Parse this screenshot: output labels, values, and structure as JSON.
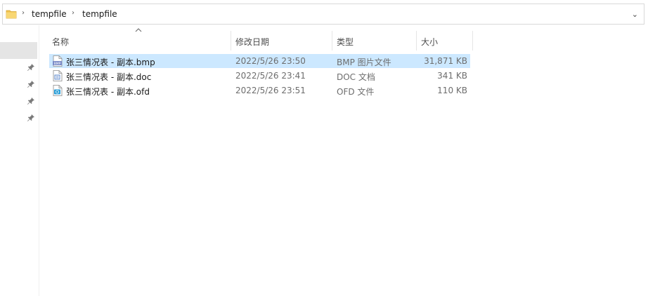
{
  "address": {
    "crumbs": [
      "tempfile",
      "tempfile"
    ],
    "separator": "›",
    "dropdown": "⌄"
  },
  "columns": {
    "name": "名称",
    "date": "修改日期",
    "type": "类型",
    "size": "大小"
  },
  "files": [
    {
      "name": "张三情况表 - 副本.bmp",
      "date": "2022/5/26 23:50",
      "type": "BMP 图片文件",
      "size": "31,871 KB",
      "icon": "bmp-file-icon",
      "selected": true
    },
    {
      "name": "张三情况表 - 副本.doc",
      "date": "2022/5/26 23:41",
      "type": "DOC 文档",
      "size": "341 KB",
      "icon": "doc-file-icon",
      "selected": false
    },
    {
      "name": "张三情况表 - 副本.ofd",
      "date": "2022/5/26 23:51",
      "type": "OFD 文件",
      "size": "110 KB",
      "icon": "ofd-file-icon",
      "selected": false
    }
  ],
  "colors": {
    "selection": "#cce8ff",
    "folder": "#f0c24d",
    "nav_selected": "#e5e5e5"
  }
}
